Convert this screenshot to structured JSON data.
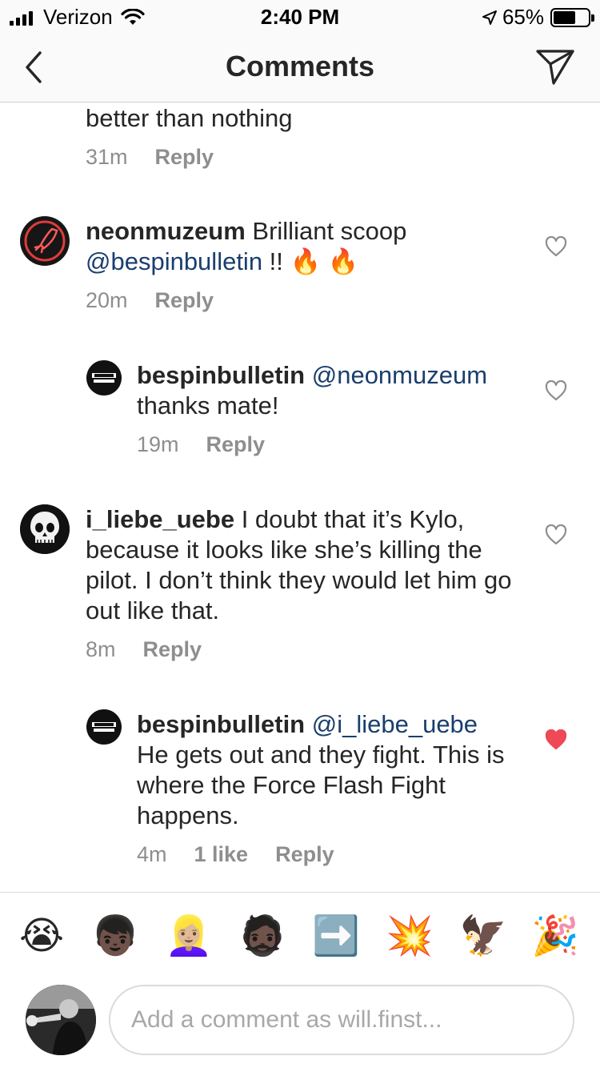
{
  "status_bar": {
    "carrier": "Verizon",
    "time": "2:40 PM",
    "battery_percent": "65%",
    "battery_level": 0.65
  },
  "nav": {
    "title": "Comments",
    "back_icon": "chevron-left-icon",
    "share_icon": "paper-plane-icon"
  },
  "comments": [
    {
      "text": "better than nothing",
      "age": "31m",
      "reply": "Reply"
    },
    {
      "username": "neonmuzeum",
      "text": " Brilliant scoop ",
      "mention": "@bespinbulletin",
      "suffix": " !! 🔥 🔥",
      "age": "20m",
      "reply": "Reply",
      "liked": false
    },
    {
      "username": "bespinbulletin",
      "mention": " @neonmuzeum",
      "text": "thanks mate!",
      "age": "19m",
      "reply": "Reply",
      "liked": false
    },
    {
      "username": "i_liebe_uebe",
      "text": " I doubt that it’s Kylo, because it looks like she’s killing the pilot. I don’t think they would let him go out like that.",
      "age": "8m",
      "reply": "Reply",
      "liked": false
    },
    {
      "username": "bespinbulletin",
      "mention": " @i_liebe_uebe",
      "text": "He gets out and they fight. This is where the Force Flash Fight happens.",
      "age": "4m",
      "likes": "1 like",
      "reply": "Reply",
      "liked": true
    }
  ],
  "emoji_bar": [
    "😭",
    "👦🏿",
    "👱🏼‍♀️",
    "🧔🏿",
    "➡️",
    "💥",
    "🦅",
    "🎉"
  ],
  "compose": {
    "placeholder": "Add a comment as will.finst..."
  },
  "colors": {
    "mention": "#1a3e6e",
    "liked_heart": "#ed4956",
    "meta_gray": "#8e8e8e"
  }
}
